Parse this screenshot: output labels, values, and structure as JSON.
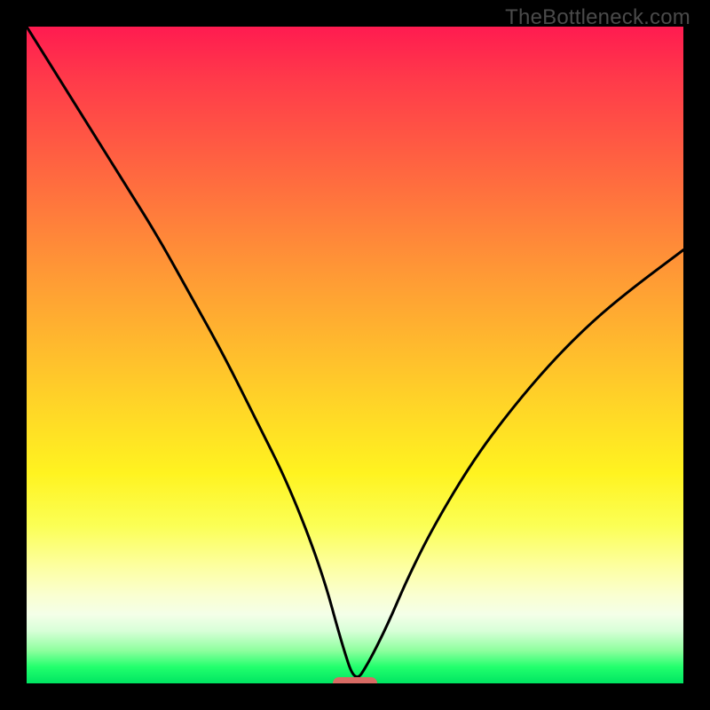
{
  "watermark": "TheBottleneck.com",
  "chart_data": {
    "type": "line",
    "title": "",
    "xlabel": "",
    "ylabel": "",
    "xlim": [
      0,
      100
    ],
    "ylim": [
      0,
      100
    ],
    "x": [
      0,
      5,
      10,
      15,
      20,
      25,
      30,
      35,
      40,
      45,
      48,
      50,
      52,
      55,
      58,
      62,
      68,
      74,
      80,
      86,
      92,
      100
    ],
    "values": [
      100,
      92,
      84,
      76,
      68,
      59,
      50,
      40,
      30,
      17,
      6,
      0,
      3,
      9,
      16,
      24,
      34,
      42,
      49,
      55,
      60,
      66
    ],
    "marker": {
      "x": 50,
      "y": 0
    },
    "gradient": {
      "stops": [
        {
          "pos": 0,
          "color": "#ff1b50"
        },
        {
          "pos": 50,
          "color": "#ffb82e"
        },
        {
          "pos": 80,
          "color": "#fdff9e"
        },
        {
          "pos": 100,
          "color": "#00e562"
        }
      ]
    }
  }
}
